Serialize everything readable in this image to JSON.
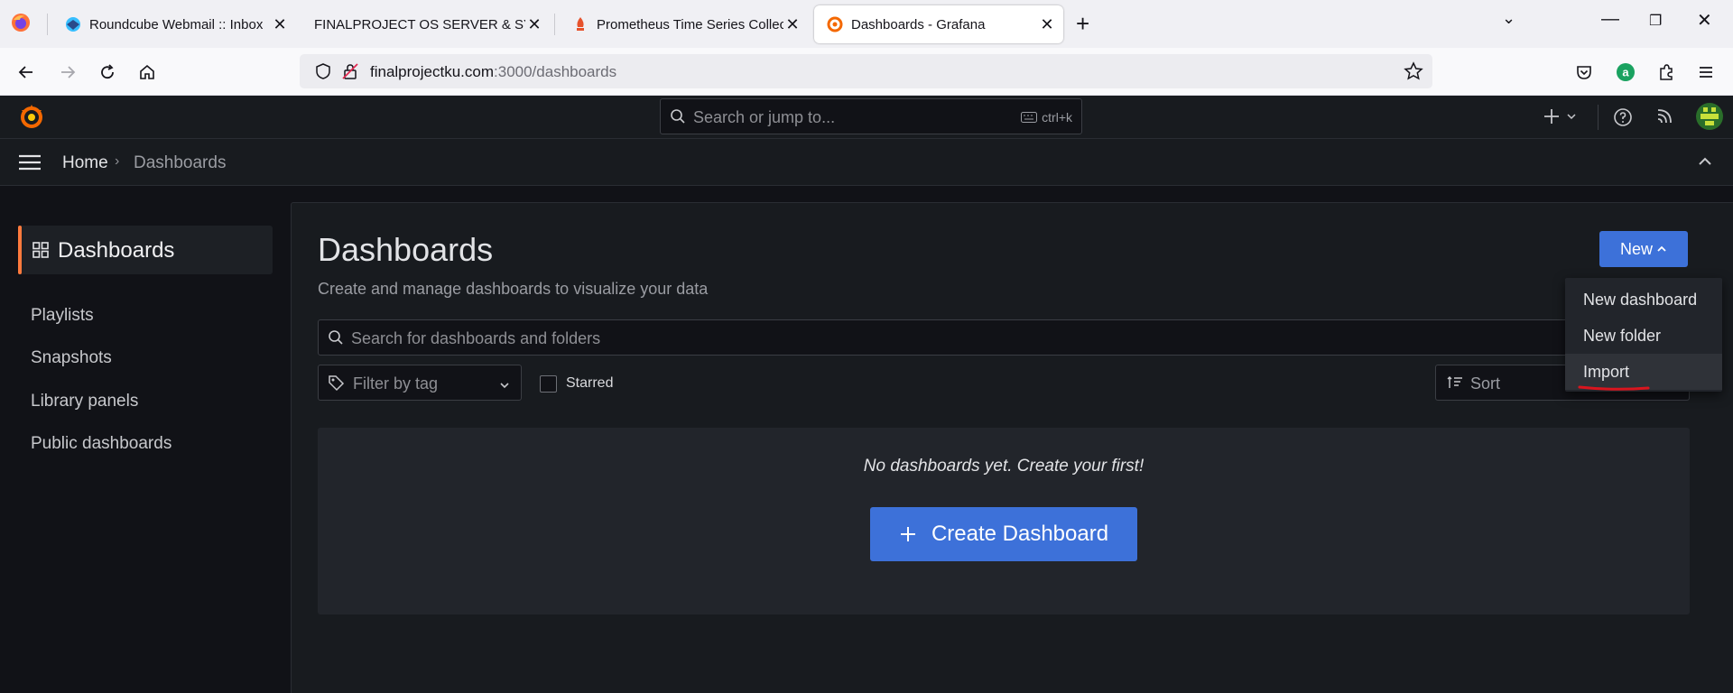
{
  "browser": {
    "tabs": [
      {
        "title": "Roundcube Webmail :: Inbox",
        "icon": "roundcube-icon"
      },
      {
        "title": "FINALPROJECT OS SERVER & SYSADMIN",
        "icon": "document-icon"
      },
      {
        "title": "Prometheus Time Series Collection",
        "icon": "prometheus-icon"
      },
      {
        "title": "Dashboards - Grafana",
        "icon": "grafana-icon",
        "active": true
      }
    ],
    "url_host": "finalprojectku.com",
    "url_path": ":3000/dashboards"
  },
  "grafana": {
    "search_placeholder": "Search or jump to...",
    "search_shortcut": "ctrl+k",
    "breadcrumb": {
      "home": "Home",
      "current": "Dashboards"
    },
    "sidebar": {
      "active": "Dashboards",
      "items": [
        "Playlists",
        "Snapshots",
        "Library panels",
        "Public dashboards"
      ]
    },
    "page": {
      "title": "Dashboards",
      "subtitle": "Create and manage dashboards to visualize your data",
      "new_button": "New",
      "search_placeholder": "Search for dashboards and folders",
      "tag_filter_placeholder": "Filter by tag",
      "starred_label": "Starred",
      "sort_placeholder": "Sort",
      "empty_message": "No dashboards yet. Create your first!",
      "create_button": "Create Dashboard"
    },
    "new_menu": {
      "items": [
        "New dashboard",
        "New folder",
        "Import"
      ],
      "highlighted": "Import"
    }
  },
  "colors": {
    "accent_blue": "#3d71d9",
    "active_orange": "#ff7a3d",
    "annotation_red": "#d9151e",
    "bg_dark": "#111217",
    "panel_dark": "#181b1f"
  }
}
